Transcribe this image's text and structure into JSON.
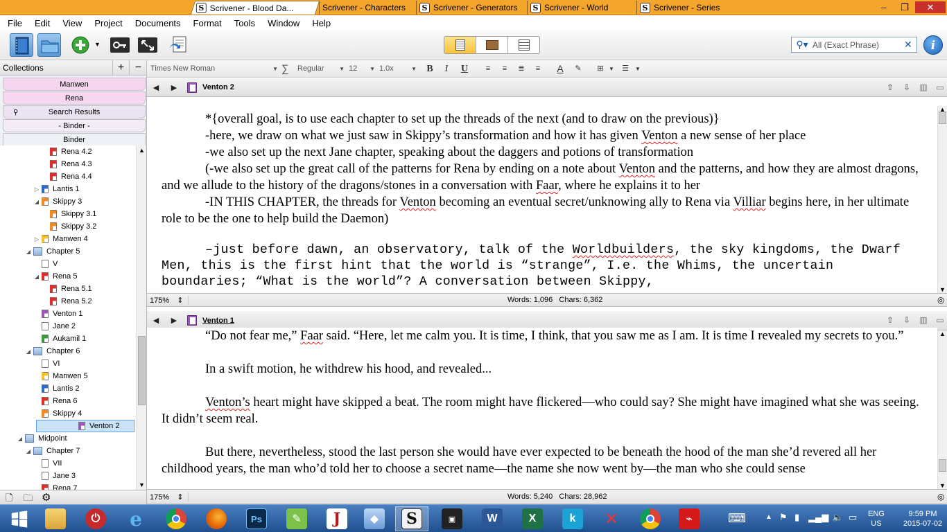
{
  "titlebar": {
    "tabs": [
      {
        "label": "Scrivener - Blood Da...",
        "active": true
      },
      {
        "label": "Scrivener - Characters",
        "active": false
      },
      {
        "label": "Scrivener - Generators",
        "active": false
      },
      {
        "label": "Scrivener - World",
        "active": false
      },
      {
        "label": "Scrivener - Series",
        "active": false
      }
    ],
    "minimize": "–",
    "restore": "❐",
    "close": "✕"
  },
  "menu": [
    "File",
    "Edit",
    "View",
    "Project",
    "Documents",
    "Format",
    "Tools",
    "Window",
    "Help"
  ],
  "toolbar": {
    "search_placeholder": "All (Exact Phrase)"
  },
  "formatbar": {
    "font": "Times New Roman",
    "style": "Regular",
    "size": "12",
    "spacing": "1.0x",
    "bold": "B",
    "italic": "I",
    "underline": "U",
    "font_color": "A"
  },
  "collections": {
    "title": "Collections",
    "add": "+",
    "remove": "−",
    "tabs": [
      "Manwen",
      "Rena",
      "Search Results",
      "- Binder -",
      "Binder"
    ]
  },
  "binder": {
    "items": [
      {
        "label": "Rena 4.2",
        "indent": 3,
        "type": "red"
      },
      {
        "label": "Rena 4.3",
        "indent": 3,
        "type": "red"
      },
      {
        "label": "Rena 4.4",
        "indent": 3,
        "type": "red"
      },
      {
        "label": "Lantis 1",
        "indent": 2,
        "type": "blue",
        "arrow": "▷"
      },
      {
        "label": "Skippy 3",
        "indent": 2,
        "type": "orange",
        "arrow": "◢"
      },
      {
        "label": "Skippy 3.1",
        "indent": 3,
        "type": "orange"
      },
      {
        "label": "Skippy 3.2",
        "indent": 3,
        "type": "orange"
      },
      {
        "label": "Manwen 4",
        "indent": 2,
        "type": "yellow",
        "arrow": "▷"
      },
      {
        "label": "Chapter 5",
        "indent": 1,
        "type": "folder",
        "arrow": "◢"
      },
      {
        "label": "V",
        "indent": 2,
        "type": "doc"
      },
      {
        "label": "Rena 5",
        "indent": 2,
        "type": "red",
        "arrow": "◢"
      },
      {
        "label": "Rena 5.1",
        "indent": 3,
        "type": "red"
      },
      {
        "label": "Rena 5.2",
        "indent": 3,
        "type": "red"
      },
      {
        "label": "Venton 1",
        "indent": 2,
        "type": "purple"
      },
      {
        "label": "Jane 2",
        "indent": 2,
        "type": "doc"
      },
      {
        "label": "Aukamil 1",
        "indent": 2,
        "type": "green"
      },
      {
        "label": "Chapter 6",
        "indent": 1,
        "type": "folder",
        "arrow": "◢"
      },
      {
        "label": "VI",
        "indent": 2,
        "type": "doc"
      },
      {
        "label": "Manwen 5",
        "indent": 2,
        "type": "yellow"
      },
      {
        "label": "Lantis 2",
        "indent": 2,
        "type": "blue"
      },
      {
        "label": "Rena 6",
        "indent": 2,
        "type": "red"
      },
      {
        "label": "Skippy 4",
        "indent": 2,
        "type": "orange"
      },
      {
        "label": "Venton 2",
        "indent": 2,
        "type": "purple",
        "selected": true
      },
      {
        "label": "Midpoint",
        "indent": 0,
        "type": "folder",
        "arrow": "◢"
      },
      {
        "label": "Chapter 7",
        "indent": 1,
        "type": "folder",
        "arrow": "◢"
      },
      {
        "label": "VII",
        "indent": 2,
        "type": "doc"
      },
      {
        "label": "Jane 3",
        "indent": 2,
        "type": "doc"
      },
      {
        "label": "Rena 7",
        "indent": 2,
        "type": "red"
      }
    ]
  },
  "editor_top": {
    "title": "Venton 2",
    "zoom": "175%",
    "words": "Words: 1,096",
    "chars": "Chars: 6,362",
    "paragraphs": [
      "*{overall goal, is to use each chapter to set up the threads of the next (and to draw on the previous)}",
      "-here, we draw on what we just saw in Skippy’s transformation and how it has given Venton a new sense of her place",
      "-we also set up the next Jane chapter, speaking about the daggers and potions of transformation",
      "(-we also set up the great call of the patterns for Rena by ending on a note about Venton and the patterns, and how they are almost dragons, and we allude to the history of the dragons/stones in a conversation with Faar, where he explains it to her",
      "-IN THIS CHAPTER, the threads for Venton becoming an eventual secret/unknowing ally to Rena via Villiar begins here, in her ultimate role to be the one to help build the Daemon)",
      "–just before dawn, an observatory, talk of the Worldbuilders, the sky kingdoms, the Dwarf Men, this is the first hint that the world is “strange”, I.e. the Whims, the uncertain boundaries; “What is the world”? A conversation between Skippy,"
    ]
  },
  "editor_bottom": {
    "title": "Venton 1",
    "zoom": "175%",
    "words": "Words: 5,240",
    "chars": "Chars: 28,962",
    "paragraphs": [
      "“Do not fear me,” Faar said. “Here, let me calm you. It is time, I think, that you saw me as I am. It is time I revealed my secrets to you.”",
      "In a swift motion, he withdrew his hood, and revealed...",
      "Venton’s heart might have skipped a beat. The room might have flickered—who could say? She might have imagined what she was seeing. It didn’t seem real.",
      "But there, nevertheless, stood the last person she would have ever expected to be beneath the hood of the man she’d revered all her childhood years, the man who’d told her to choose a secret name—the name she now went by—the man who she could sense"
    ]
  },
  "taskbar": {
    "lang1": "ENG",
    "lang2": "US",
    "time": "9:59 PM",
    "date": "2015-07-02"
  },
  "colors": {
    "titlebar": "#f4a52c",
    "red": "#d9302c",
    "blue": "#2f6cc2",
    "orange": "#f08a24",
    "yellow": "#f4c430",
    "purple": "#9b59b6",
    "green": "#3a9a3a"
  }
}
